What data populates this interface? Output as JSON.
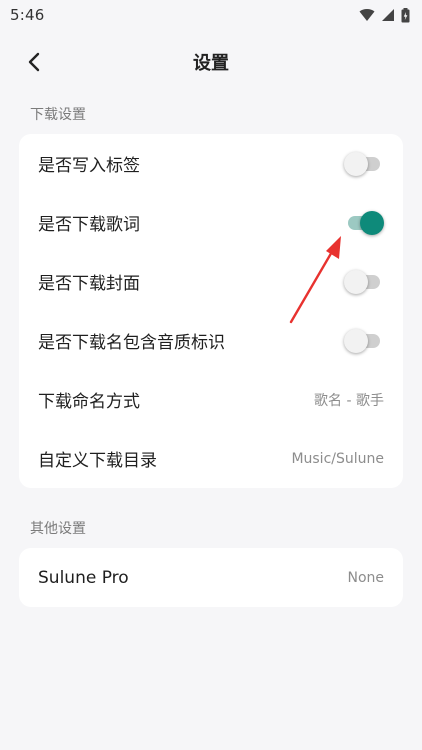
{
  "status_bar": {
    "time": "5:46",
    "icons": [
      "wifi-icon",
      "signal-icon",
      "battery-icon"
    ]
  },
  "app_bar": {
    "title": "设置",
    "back_icon": "chevron-left-icon"
  },
  "download_section": {
    "header": "下载设置",
    "rows": [
      {
        "label": "是否写入标签",
        "type": "toggle",
        "on": false
      },
      {
        "label": "是否下载歌词",
        "type": "toggle",
        "on": true
      },
      {
        "label": "是否下载封面",
        "type": "toggle",
        "on": false
      },
      {
        "label": "是否下载名包含音质标识",
        "type": "toggle",
        "on": false
      },
      {
        "label": "下载命名方式",
        "type": "value",
        "value": "歌名 - 歌手"
      },
      {
        "label": "自定义下载目录",
        "type": "value",
        "value": "Music/Sulune"
      }
    ]
  },
  "other_section": {
    "header": "其他设置",
    "rows": [
      {
        "label": "Sulune Pro",
        "type": "value",
        "value": "None"
      }
    ]
  },
  "colors": {
    "accent": "#0e8a7a",
    "accent_track": "#9cc9c2",
    "annotation_arrow": "#e8322f",
    "background": "#f6f6f8",
    "card": "#ffffff"
  }
}
